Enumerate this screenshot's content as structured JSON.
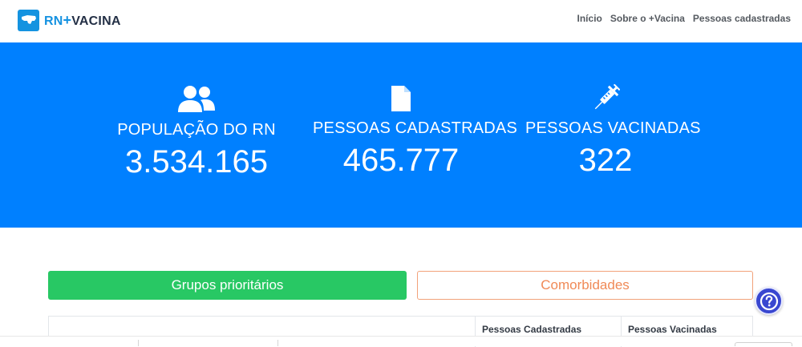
{
  "header": {
    "logo_rn": "RN",
    "logo_plus": "+",
    "logo_name": "VACINA",
    "nav": [
      "Início",
      "Sobre o +Vacina",
      "Pessoas cadastradas"
    ]
  },
  "stats": [
    {
      "icon": "users-icon",
      "label": "POPULAÇÃO DO RN",
      "value": "3.534.165"
    },
    {
      "icon": "file-icon",
      "label": "PESSOAS CADASTRADAS",
      "value": "465.777"
    },
    {
      "icon": "syringe-icon",
      "label": "PESSOAS VACINADAS",
      "value": "322"
    }
  ],
  "buttons": {
    "groups": "Grupos prioritários",
    "comorbidities": "Comorbidades"
  },
  "table": {
    "headers": [
      "Pessoas Cadastradas",
      "Pessoas Vacinadas"
    ]
  },
  "colors": {
    "hero": "#0080ff",
    "green": "#28c864",
    "orange": "#f08a57",
    "help": "#3947d0"
  }
}
